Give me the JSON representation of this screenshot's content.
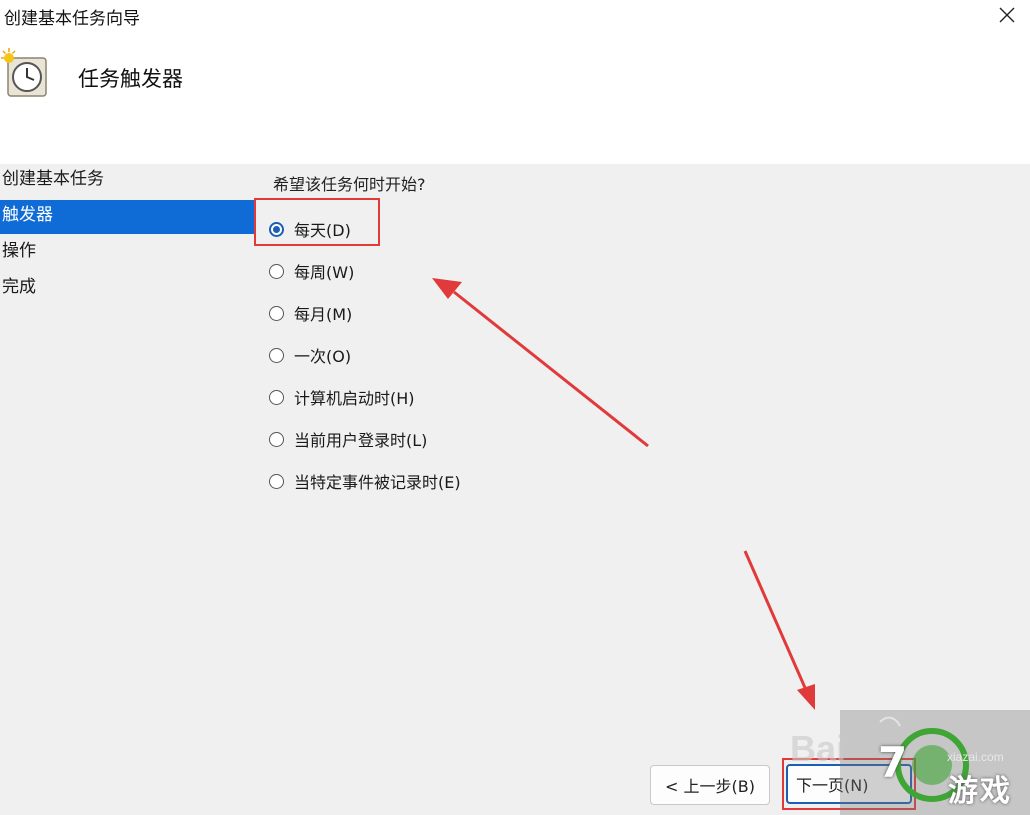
{
  "window": {
    "title": "创建基本任务向导"
  },
  "header": {
    "title": "任务触发器"
  },
  "sidebar": {
    "items": [
      {
        "label": "创建基本任务",
        "active": false
      },
      {
        "label": "触发器",
        "active": true
      },
      {
        "label": "操作",
        "active": false
      },
      {
        "label": "完成",
        "active": false
      }
    ]
  },
  "main": {
    "question": "希望该任务何时开始?",
    "options": [
      {
        "label": "每天(D)",
        "checked": true
      },
      {
        "label": "每周(W)",
        "checked": false
      },
      {
        "label": "每月(M)",
        "checked": false
      },
      {
        "label": "一次(O)",
        "checked": false
      },
      {
        "label": "计算机启动时(H)",
        "checked": false
      },
      {
        "label": "当前用户登录时(L)",
        "checked": false
      },
      {
        "label": "当特定事件被记录时(E)",
        "checked": false
      }
    ]
  },
  "buttons": {
    "back": "< 上一步(B)",
    "next": "下一页(N)"
  },
  "watermark": {
    "baidu": "Bai",
    "number": "7",
    "site": "xiazai.com",
    "name": "游戏"
  },
  "icons": {
    "close": "close-icon",
    "wizard": "clock-task-icon"
  },
  "colors": {
    "accent": "#0f6cd6",
    "annotation": "#e03a3a"
  }
}
